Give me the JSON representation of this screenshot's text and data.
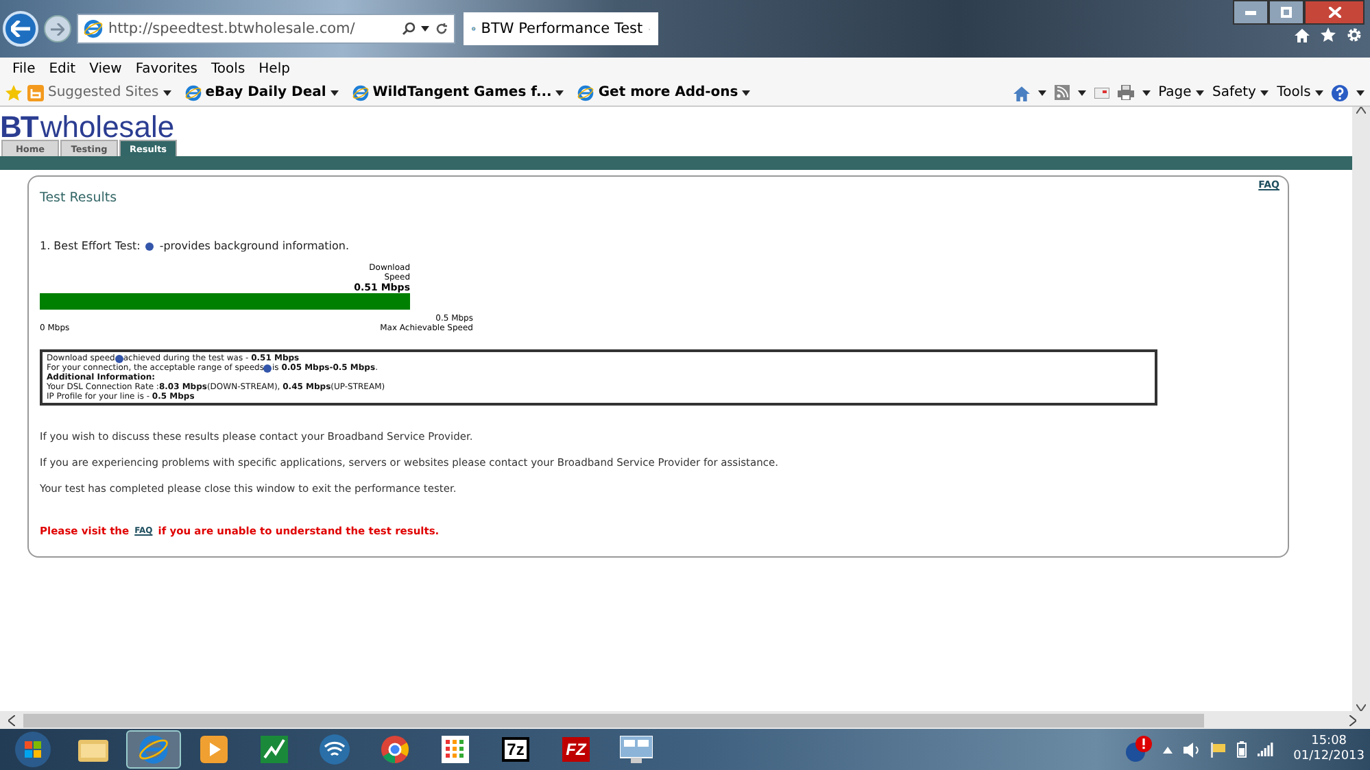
{
  "browser": {
    "address": "http://speedtest.btwholesale.com/",
    "tab_title": "BTW Performance Test"
  },
  "menu": [
    "File",
    "Edit",
    "View",
    "Favorites",
    "Tools",
    "Help"
  ],
  "favorites": [
    {
      "label": "Suggested Sites",
      "kind": "suggested"
    },
    {
      "label": "eBay Daily Deal",
      "kind": "page"
    },
    {
      "label": "WildTangent Games f...",
      "kind": "page"
    },
    {
      "label": "Get more Add-ons",
      "kind": "page"
    }
  ],
  "commands": [
    "Page",
    "Safety",
    "Tools"
  ],
  "site": {
    "logo_bold": "BT",
    "logo_text": "wholesale",
    "tabs": [
      {
        "label": "Home",
        "selected": false
      },
      {
        "label": "Testing",
        "selected": false
      },
      {
        "label": "Results",
        "selected": true
      }
    ],
    "faq_link": "FAQ",
    "heading": "Test Results",
    "test_line": {
      "before": "1. Best Effort Test:",
      "after": "-provides background information."
    },
    "meter": {
      "title_lines": [
        "Download",
        "Speed"
      ],
      "value": "0.51 Mbps",
      "min_label": "0 Mbps",
      "max_value": "0.5 Mbps",
      "max_label": "Max Achievable Speed"
    },
    "details": [
      {
        "before": "Download speed",
        "info": true,
        "after": "achieved during the test was - **0.51 Mbps**"
      },
      {
        "before": "For your connection, the acceptable range of speeds",
        "info": true,
        "after": " is **0.05 Mbps-0.5 Mbps**."
      },
      {
        "before": "**Additional Information:**"
      },
      {
        "before": "Your DSL Connection Rate :**8.03 Mbps**(DOWN-STREAM), **0.45 Mbps**(UP-STREAM)"
      },
      {
        "before": "IP Profile for your line is - **0.5 Mbps**"
      }
    ],
    "paragraphs": [
      "If you wish to discuss these results please contact your Broadband Service Provider.",
      "If you are experiencing problems with specific applications, servers or websites please contact your Broadband Service Provider for assistance.",
      "Your test has completed please close this window to exit the performance tester."
    ],
    "warning": {
      "before": "Please visit the",
      "link": "FAQ",
      "after": "if you are unable to understand the test results."
    }
  },
  "taskbar": {
    "apps": [
      {
        "kind": "folder",
        "active": false
      },
      {
        "kind": "ie",
        "active": true
      },
      {
        "kind": "media",
        "active": false
      },
      {
        "kind": "chart",
        "active": false
      },
      {
        "kind": "wifi",
        "active": false
      },
      {
        "kind": "chrome",
        "active": false
      },
      {
        "kind": "grid",
        "active": false
      },
      {
        "kind": "archiver",
        "label": "7z",
        "active": false
      },
      {
        "kind": "ftp",
        "label": "FZ",
        "active": false
      },
      {
        "kind": "remote",
        "active": false
      }
    ],
    "time": "15:08",
    "date": "01/12/2013"
  }
}
